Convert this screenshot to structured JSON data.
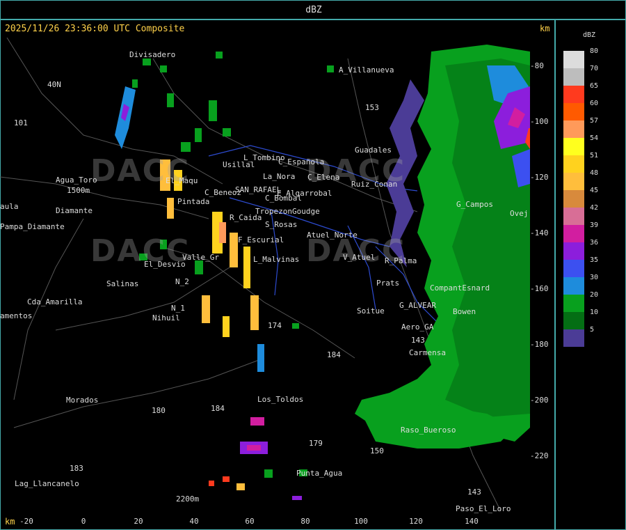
{
  "header": {
    "title": "dBZ"
  },
  "map": {
    "timestamp": "2025/11/26 23:36:00 UTC Composite",
    "km_top": "km",
    "km_bottom": "km",
    "y_ticks": [
      "-80",
      "-100",
      "-120",
      "-140",
      "-160",
      "-180",
      "-200",
      "-220"
    ],
    "x_ticks": [
      "-20",
      "0",
      "20",
      "40",
      "60",
      "80",
      "100",
      "120",
      "140"
    ],
    "watermark_text": "DACC",
    "places": [
      "Divisadero",
      "A_Villanueva",
      "40N",
      "101",
      "153",
      "Guadales",
      "L_Tombino",
      "Usillal",
      "C_Española",
      "La_Nora",
      "C_Elena",
      "Agua_Toro",
      "1500m",
      "Diamante",
      "El_Maqu",
      "Pintada",
      "C_Beneoz",
      "SAN_RAFAEL",
      "E_Algarrobal",
      "Ruiz_Conan",
      "C_Bombal",
      "G_Campos",
      "Ovej",
      "aula",
      "Pampa_Diamante",
      "Tropezon",
      "Goudge",
      "R_Caida",
      "S_Rosas",
      "Atuel_Norte",
      "F_Escurial",
      "Valle_Gr",
      "L_Malvinas",
      "El_Desvio",
      "V_Atuel",
      "R_Palma",
      "Salinas",
      "N_2",
      "Prats",
      "CompantEsnard",
      "Cda_Amarilla",
      "N_1",
      "G_ALVEAR",
      "Bowen",
      "amentos",
      "Nihuil",
      "Soitue",
      "Aero_GA",
      "143",
      "174",
      "184",
      "Carmensa",
      "Morados",
      "180",
      "Los_Toldos",
      "184",
      "183",
      "179",
      "150",
      "Raso_Bueroso",
      "Lag_Llancanelo",
      "Punta_Agua",
      "2200m",
      "143",
      "Paso_El_Loro"
    ]
  },
  "legend": {
    "title": "dBZ",
    "levels": [
      {
        "label": "80",
        "color": "#dcdcdc"
      },
      {
        "label": "70",
        "color": "#bdbdbd"
      },
      {
        "label": "65",
        "color": "#ff3a1e"
      },
      {
        "label": "60",
        "color": "#ff5a00"
      },
      {
        "label": "57",
        "color": "#ff9a5a"
      },
      {
        "label": "54",
        "color": "#ffff1e"
      },
      {
        "label": "51",
        "color": "#ffd21e"
      },
      {
        "label": "48",
        "color": "#ffbe3c"
      },
      {
        "label": "45",
        "color": "#d88a3c"
      },
      {
        "label": "42",
        "color": "#d86e96"
      },
      {
        "label": "39",
        "color": "#d21ea0"
      },
      {
        "label": "36",
        "color": "#8c1edc"
      },
      {
        "label": "35",
        "color": "#3c50f0"
      },
      {
        "label": "30",
        "color": "#1e8cdc"
      },
      {
        "label": "20",
        "color": "#08a01e"
      },
      {
        "label": "10",
        "color": "#046e14"
      },
      {
        "label": "5",
        "color": "#4b3c96"
      }
    ]
  }
}
